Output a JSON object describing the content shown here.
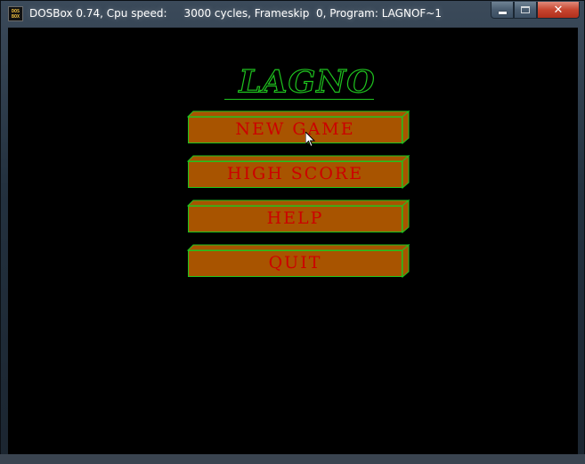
{
  "window": {
    "icon_line1": "DOS",
    "icon_line2": "BOX",
    "title": "DOSBox 0.74, Cpu speed:     3000 cycles, Frameskip  0, Program: LAGNOF~1",
    "close_glyph": "✕"
  },
  "game": {
    "title": "LAGNO",
    "menu": [
      {
        "label": "NEW GAME"
      },
      {
        "label": "HIGH SCORE"
      },
      {
        "label": "HELP"
      },
      {
        "label": "QUIT"
      }
    ]
  },
  "colors": {
    "background": "#000000",
    "title_green": "#1fc41f",
    "button_fill": "#a85400",
    "button_border": "#1fc41f",
    "label_red": "#cc0000"
  },
  "icons": {
    "app": "dosbox-icon",
    "minimize": "minimize-icon",
    "maximize": "maximize-icon",
    "close": "close-icon",
    "pointer": "mouse-pointer-icon"
  }
}
